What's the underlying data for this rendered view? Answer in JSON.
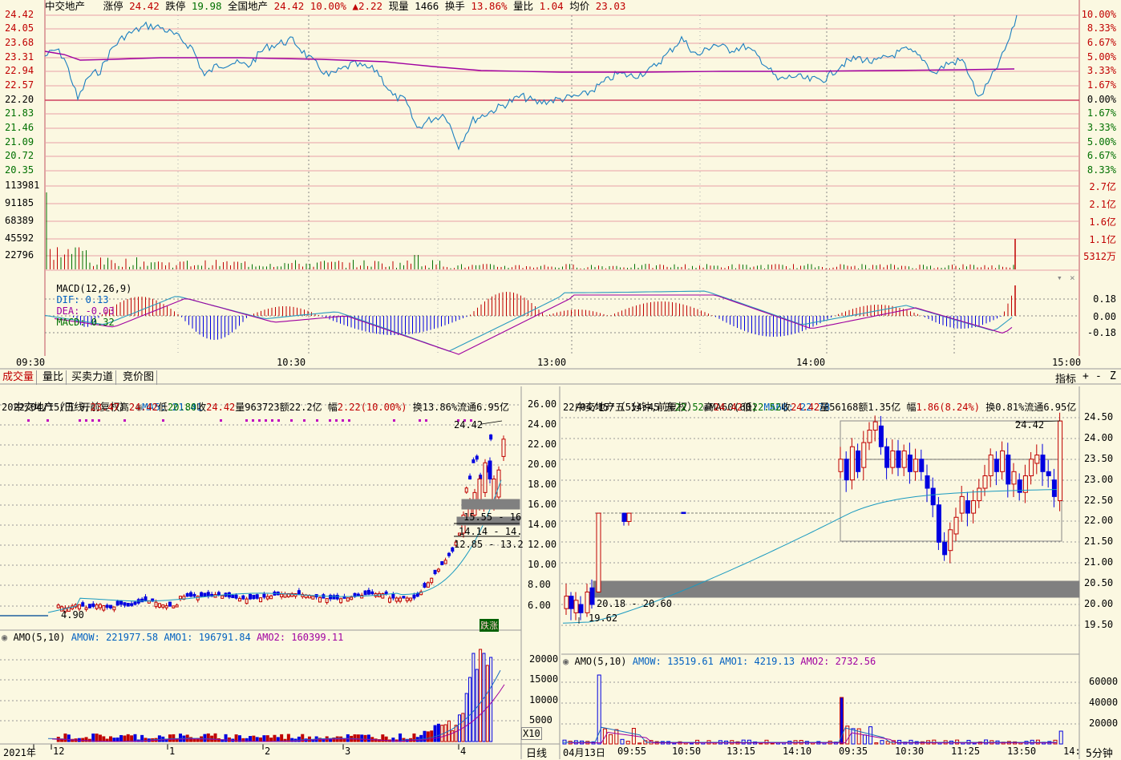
{
  "top_header": {
    "name": "中交地产",
    "zt_label": "涨停",
    "zt_value": "24.42",
    "dt_label": "跌停",
    "dt_value": "19.98",
    "sector": "全国地产",
    "sector_price": "24.42",
    "sector_pct": "10.00%",
    "change": "▲2.22",
    "vol_label": "现量",
    "vol_value": "1466",
    "turn_label": "换手",
    "turn_value": "13.86%",
    "ratio_label": "量比",
    "ratio_value": "1.04",
    "avg_label": "均价",
    "avg_value": "23.03"
  },
  "price_axis_left": [
    "24.42",
    "24.05",
    "23.68",
    "23.31",
    "22.94",
    "22.57",
    "22.20",
    "21.83",
    "21.46",
    "21.09",
    "20.72",
    "20.35"
  ],
  "price_axis_right": [
    "10.00%",
    "8.33%",
    "6.67%",
    "5.00%",
    "3.33%",
    "1.67%",
    "0.00%",
    "1.67%",
    "3.33%",
    "5.00%",
    "6.67%",
    "8.33%"
  ],
  "vol_axis_left": [
    "113981",
    "91185",
    "68389",
    "45592",
    "22796"
  ],
  "vol_axis_right": [
    "2.7亿",
    "2.1亿",
    "1.6亿",
    "1.1亿",
    "5312万"
  ],
  "macd_header": {
    "title": "MACD(12,26,9)",
    "dif": "DIF: 0.13",
    "dea": "DEA: -0.03",
    "macd": "MACD: 0.32"
  },
  "macd_axis": [
    "0.18",
    "0.00",
    "-0.18"
  ],
  "time_axis": [
    "09:30",
    "10:30",
    "13:00",
    "14:00",
    "15:00"
  ],
  "tabs": [
    "成交量",
    "量比",
    "买卖力道",
    "竞价图"
  ],
  "tabs_right": {
    "indicator": "指标",
    "plus": "+",
    "minus": "-",
    "z": "Z"
  },
  "left_panel": {
    "title": "中交地产（日线,前复权）",
    "ma": "MA5: 21.41",
    "line2": {
      "date": "2022/04/15/五",
      "open_l": "开",
      "open": "23.47",
      "high_l": "高",
      "high": "24.42",
      "low_l": "低",
      "low": "20.80",
      "close_l": "收",
      "close": "24.42",
      "vol": "量963723",
      "amt": "额22.2亿",
      "pct_l": "幅",
      "pct": "2.22(10.00%)",
      "turn": "换13.86%",
      "float": "流通6.95亿"
    },
    "axis": [
      "26.00",
      "24.00",
      "22.00",
      "20.00",
      "18.00",
      "16.00",
      "14.00",
      "12.00",
      "10.00",
      "8.00",
      "6.00"
    ],
    "max_label": "24.42",
    "min_label": "4.90",
    "zones": [
      "15.55 - 16",
      "14.14 - 14.",
      "12.85 - 13.2"
    ],
    "zhangdie": "跌涨",
    "amo": {
      "title": "AMO(5,10)",
      "amow": "AMOW: 221977.58",
      "amo1": "AMO1: 196791.84",
      "amo2": "AMO2: 160399.11"
    },
    "amo_axis": [
      "20000",
      "15000",
      "10000",
      "5000"
    ],
    "x10": "X10",
    "dates": [
      "2021年",
      "12",
      "1",
      "2",
      "3",
      "4"
    ],
    "period": "日线"
  },
  "right_panel": {
    "title": "中交地产（5分钟,前复权）",
    "ma": "MA60(60)",
    "ma_value": "MA60: 22.78",
    "line2": {
      "date": "22/04/15/五",
      "time": "14:45",
      "open_l": "开",
      "open": "22.52",
      "high_l": "高",
      "high": "24.42",
      "low_l": "低",
      "low": "22.52",
      "close_l": "收",
      "close": "24.42",
      "vol": "量56168",
      "amt": "额1.35亿",
      "pct_l": "幅",
      "pct": "1.86(8.24%)",
      "turn": "换0.81%",
      "float": "流通6.95亿"
    },
    "axis": [
      "24.50",
      "24.00",
      "23.50",
      "23.00",
      "22.50",
      "22.00",
      "21.50",
      "21.00",
      "20.50",
      "20.00",
      "19.50"
    ],
    "max_label": "24.42",
    "min_label": "19.62",
    "zone": "20.18 - 20.60",
    "amo": {
      "title": "AMO(5,10)",
      "amow": "AMOW: 13519.61",
      "amo1": "AMO1: 4219.13",
      "amo2": "AMO2: 2732.56"
    },
    "amo_axis": [
      "60000",
      "40000",
      "20000"
    ],
    "times": [
      "04月13日",
      "09:55",
      "10:50",
      "13:15",
      "14:10",
      "09:35",
      "10:30",
      "11:25",
      "13:50",
      "14:"
    ],
    "period": "5分钟"
  },
  "colors": {
    "bg": "#fbf8e1",
    "up": "#c00000",
    "down": "#0000e0",
    "price_line": "#1a7fc0",
    "avg_line": "#a000a0",
    "grid": "#e8a0a8"
  }
}
